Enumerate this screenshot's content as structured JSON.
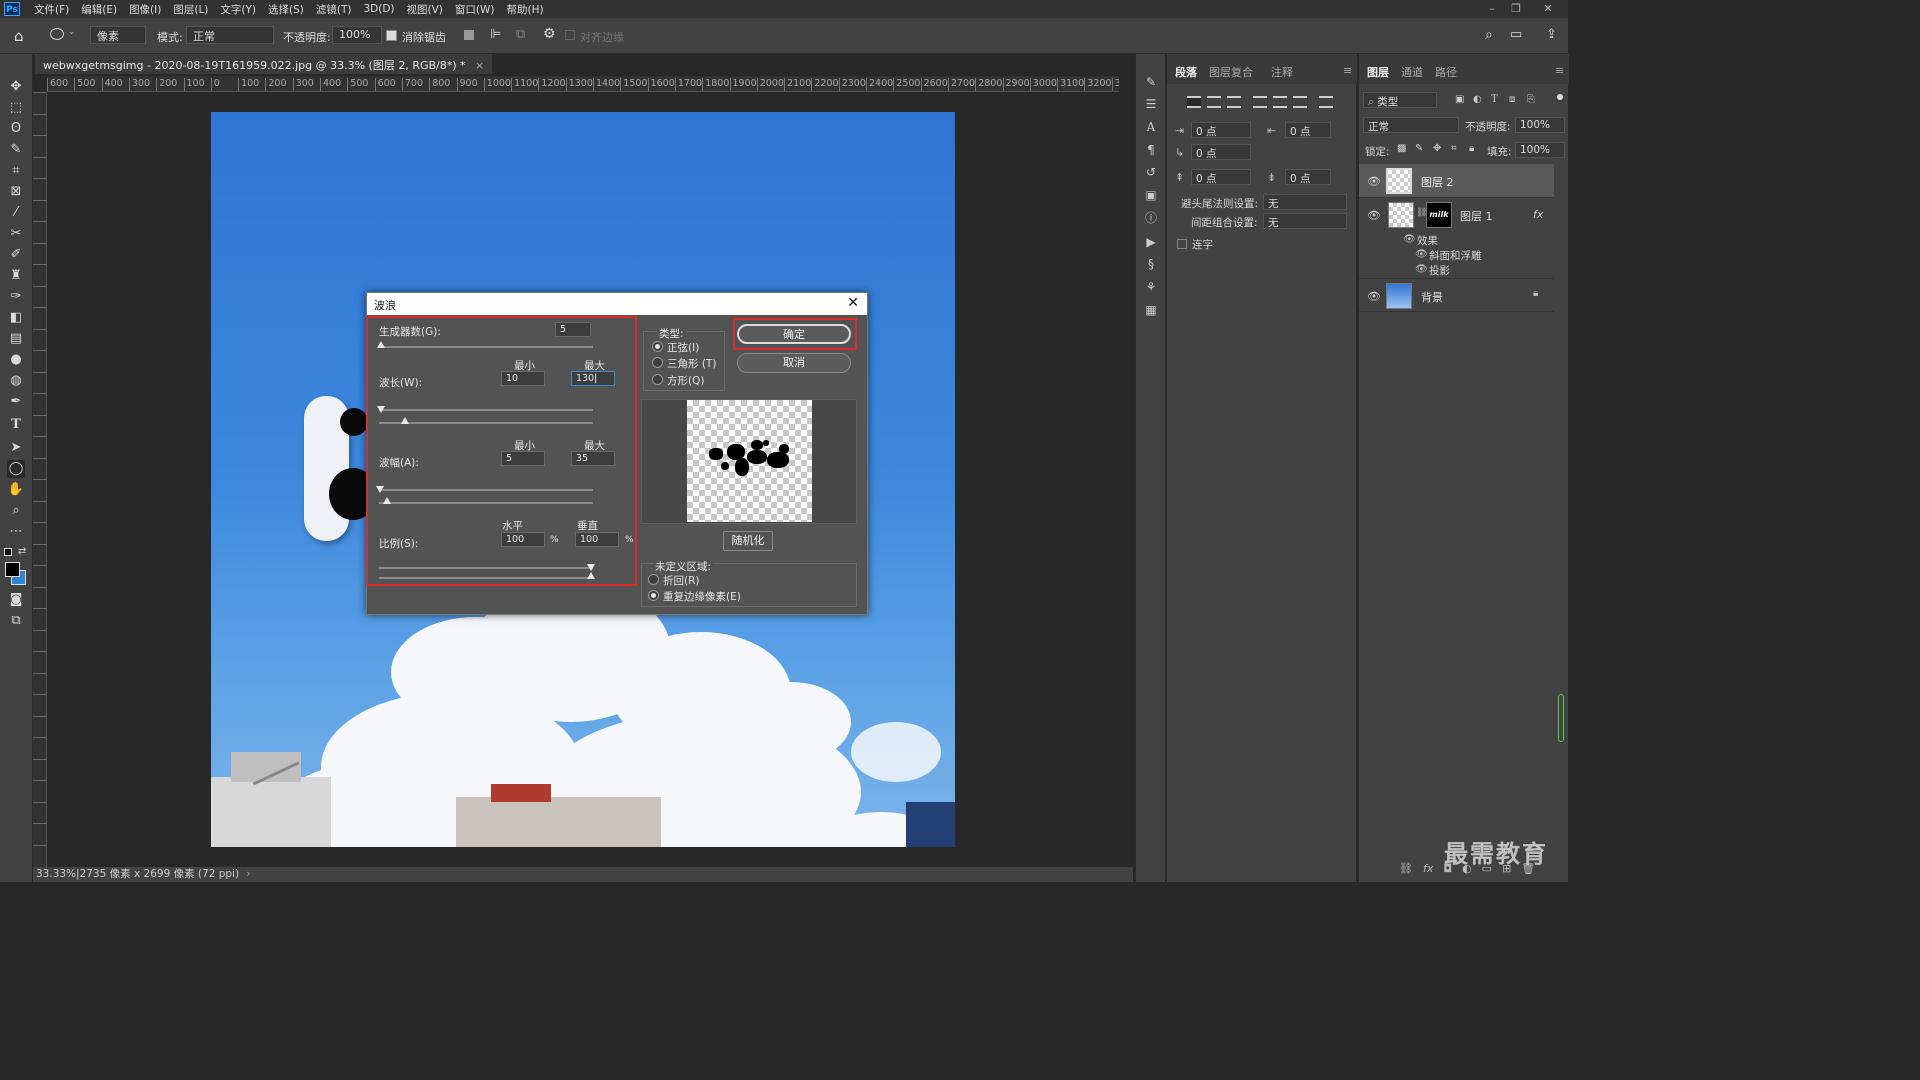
{
  "app": {
    "logo": "Ps"
  },
  "menu": [
    "文件(F)",
    "编辑(E)",
    "图像(I)",
    "图层(L)",
    "文字(Y)",
    "选择(S)",
    "滤镜(T)",
    "3D(D)",
    "视图(V)",
    "窗口(W)",
    "帮助(H)"
  ],
  "options": {
    "unit": "像素",
    "mode_label": "模式:",
    "mode_value": "正常",
    "opacity_label": "不透明度:",
    "opacity_value": "100%",
    "antialias": "消除锯齿",
    "align_edges": "对齐边缘"
  },
  "document": {
    "tab_title": "webwxgetmsgimg - 2020-08-19T161959.022.jpg @ 33.3% (图层 2, RGB/8*) *",
    "ruler_ticks": [
      "600",
      "500",
      "400",
      "300",
      "200",
      "100",
      "0",
      "100",
      "200",
      "300",
      "400",
      "500",
      "600",
      "700",
      "800",
      "900",
      "1000",
      "1100",
      "1200",
      "1300",
      "1400",
      "1500",
      "1600",
      "1700",
      "1800",
      "1900",
      "2000",
      "2100",
      "2200",
      "2300",
      "2400",
      "2500",
      "2600",
      "2700",
      "2800",
      "2900",
      "3000",
      "3100",
      "3200",
      "33"
    ],
    "status": "33.33%|2735 像素 x 2699 像素 (72 ppi)"
  },
  "paragraph_panel": {
    "tabs": [
      "段落",
      "图层复合",
      "注释"
    ],
    "indent_left": "0 点",
    "indent_right": "0 点",
    "indent_first": "0 点",
    "space_before": "0 点",
    "space_after": "0 点",
    "kinsoku_label": "避头尾法则设置:",
    "kinsoku_value": "无",
    "mojikumi_label": "间距组合设置:",
    "mojikumi_value": "无",
    "hyphenate": "连字"
  },
  "layers_panel": {
    "tabs": [
      "图层",
      "通道",
      "路径"
    ],
    "filter_kind": "类型",
    "blend_mode": "正常",
    "opacity_label": "不透明度:",
    "opacity_value": "100%",
    "lock_label": "锁定:",
    "fill_label": "填充:",
    "fill_value": "100%",
    "layers": [
      {
        "name": "图层 2"
      },
      {
        "name": "图层 1",
        "fx": "fx"
      },
      {
        "name": "效果"
      },
      {
        "name": "斜面和浮雕"
      },
      {
        "name": "投影"
      },
      {
        "name": "背景"
      }
    ],
    "milk_text": "milk"
  },
  "wave_dialog": {
    "title": "波浪",
    "generators_label": "生成器数(G):",
    "generators_value": "5",
    "min_label": "最小",
    "max_label": "最大",
    "wavelength_label": "波长(W):",
    "wavelength_min": "10",
    "wavelength_max": "130",
    "amplitude_label": "波幅(A):",
    "amplitude_min": "5",
    "amplitude_max": "35",
    "horizontal_label": "水平",
    "vertical_label": "垂直",
    "scale_label": "比例(S):",
    "scale_h": "100",
    "scale_v": "100",
    "percent": "%",
    "type_label": "类型:",
    "type_sine": "正弦(I)",
    "type_triangle": "三角形 (T)",
    "type_square": "方形(Q)",
    "ok": "确定",
    "cancel": "取消",
    "randomize": "随机化",
    "undefined_label": "未定义区域:",
    "wrap_around": "折回(R)",
    "repeat_edge": "重复边缘像素(E)"
  },
  "watermark": "最需教育"
}
